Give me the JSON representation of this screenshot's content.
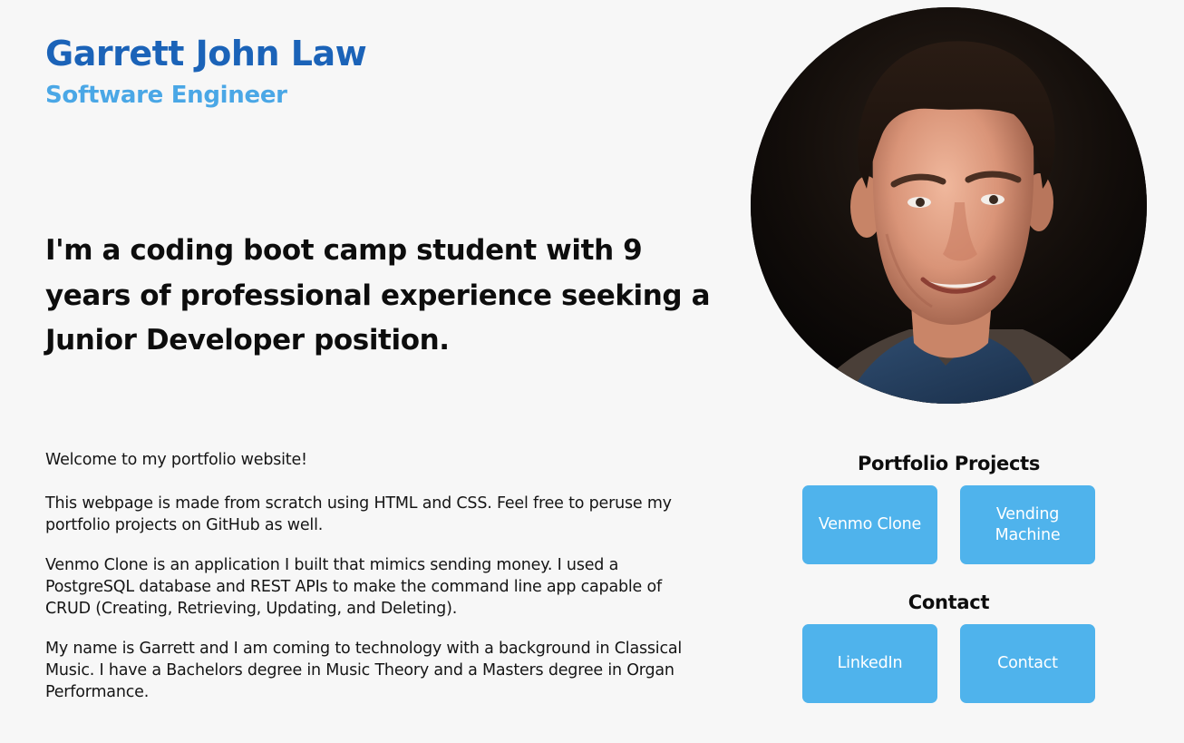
{
  "header": {
    "name": "Garrett John Law",
    "role": "Software Engineer"
  },
  "tagline": "I'm a coding boot camp student with 9 years of professional experience seeking a Junior Developer position.",
  "photo": {
    "icon": "profile-photo"
  },
  "bio": {
    "paragraphs": [
      "Welcome to my portfolio website!",
      "This webpage is made from scratch using HTML and CSS. Feel free to peruse my portfolio projects on GitHub as well.",
      "Venmo Clone is an application I built that mimics sending money. I used a PostgreSQL database and REST APIs to make the command line app capable of CRUD (Creating, Retrieving, Updating, and Deleting).",
      "My name is Garrett and I am coming to technology with a background in Classical Music. I have a Bachelors degree in Music Theory and a Masters degree in Organ Performance."
    ]
  },
  "portfolio": {
    "title": "Portfolio Projects",
    "buttons": [
      "Venmo Clone",
      "Vending Machine"
    ]
  },
  "contact": {
    "title": "Contact",
    "buttons": [
      "LinkedIn",
      "Contact"
    ]
  },
  "colors": {
    "name": "#1b63b8",
    "role": "#4aa7e6",
    "button": "#4fb3ec",
    "background": "#f7f7f7"
  }
}
